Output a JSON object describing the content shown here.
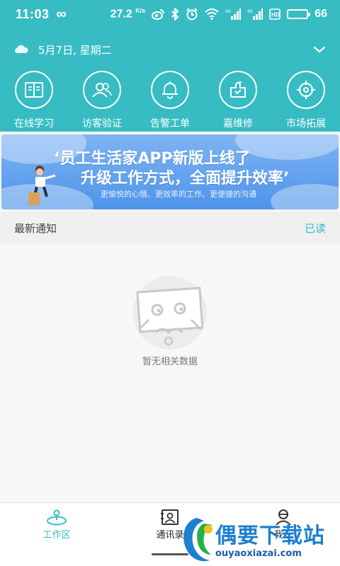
{
  "status_bar": {
    "time": "11:03",
    "speed_value": "27.2",
    "speed_unit": "K/s",
    "signal_label_1": "4G",
    "signal_label_2": "4G",
    "battery_level": 0.66,
    "battery_text": "66"
  },
  "header": {
    "weather_icon": "cloud-icon",
    "date": "5月7日, 星期二",
    "quick_actions": [
      {
        "label": "在线学习",
        "icon": "book-icon"
      },
      {
        "label": "访客验证",
        "icon": "users-icon"
      },
      {
        "label": "告警工单",
        "icon": "bell-icon"
      },
      {
        "label": "嘉维修",
        "icon": "repair-icon"
      },
      {
        "label": "市场拓展",
        "icon": "target-icon"
      }
    ]
  },
  "banner": {
    "line1": "‘员工生活家APP新版上线了",
    "line2": "升级工作方式，全面提升效率’",
    "line3": "更愉悦的心情、更效率的工作、更便捷的沟通"
  },
  "notices": {
    "title": "最新通知",
    "read_label": "已读",
    "empty_text": "暂无相关数据"
  },
  "bottom_nav": {
    "items": [
      {
        "label": "工作区",
        "icon": "workspace-icon",
        "active": true
      },
      {
        "label": "通讯录",
        "icon": "contacts-icon",
        "active": false
      },
      {
        "label": "我的",
        "icon": "profile-icon",
        "active": false
      }
    ]
  },
  "watermark": {
    "title": "偶要下载站",
    "url": "ouyaoxiazai.com"
  },
  "colors": {
    "primary": "#37bcc3",
    "banner": "#5b9cee",
    "watermark": "#1d7fcf"
  }
}
